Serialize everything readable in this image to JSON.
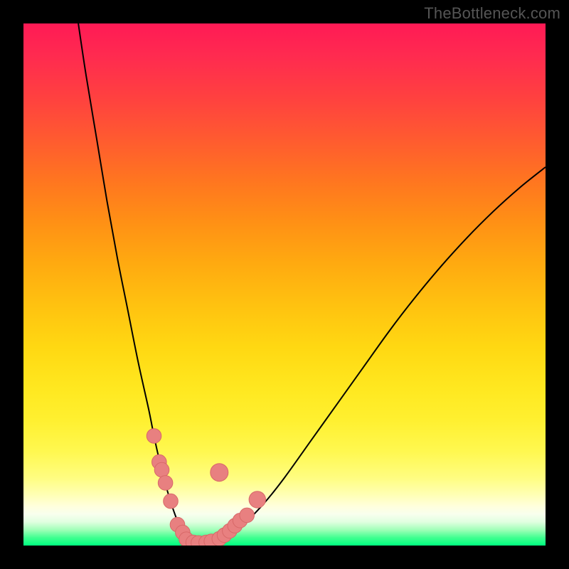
{
  "watermark": "TheBottleneck.com",
  "chart_data": {
    "type": "line",
    "title": "",
    "xlabel": "",
    "ylabel": "",
    "xlim": [
      0,
      100
    ],
    "ylim": [
      0,
      100
    ],
    "annotations": [],
    "series": [
      {
        "name": "bottleneck-curve",
        "x": [
          10.5,
          12,
          14,
          16,
          18,
          20,
          22,
          24,
          25,
          26,
          27,
          28,
          29,
          30,
          31,
          32.5,
          34,
          36,
          38,
          42,
          46,
          50,
          55,
          60,
          65,
          70,
          75,
          80,
          85,
          90,
          95,
          100
        ],
        "values": [
          100,
          90,
          78,
          66,
          55,
          45,
          35,
          26,
          21,
          16.5,
          12.5,
          9,
          6,
          3.5,
          1.8,
          0.5,
          0.5,
          0.8,
          1.5,
          4,
          8,
          13,
          20,
          27,
          34,
          41,
          47.5,
          53.5,
          59,
          64,
          68.5,
          72.5
        ]
      }
    ],
    "markers": [
      {
        "x": 25.0,
        "y": 21.0,
        "r": 1.4
      },
      {
        "x": 26.0,
        "y": 16.0,
        "r": 1.4
      },
      {
        "x": 26.5,
        "y": 14.5,
        "r": 1.4
      },
      {
        "x": 27.2,
        "y": 12.0,
        "r": 1.4
      },
      {
        "x": 28.2,
        "y": 8.5,
        "r": 1.4
      },
      {
        "x": 29.5,
        "y": 4.0,
        "r": 1.4
      },
      {
        "x": 30.5,
        "y": 2.5,
        "r": 1.4
      },
      {
        "x": 31.2,
        "y": 1.2,
        "r": 1.4
      },
      {
        "x": 32.5,
        "y": 0.6,
        "r": 1.4
      },
      {
        "x": 33.5,
        "y": 0.5,
        "r": 1.4
      },
      {
        "x": 35.0,
        "y": 0.6,
        "r": 1.4
      },
      {
        "x": 36.0,
        "y": 0.8,
        "r": 1.4
      },
      {
        "x": 37.5,
        "y": 1.3,
        "r": 1.4
      },
      {
        "x": 38.5,
        "y": 2.0,
        "r": 1.4
      },
      {
        "x": 39.5,
        "y": 2.8,
        "r": 1.4
      },
      {
        "x": 40.5,
        "y": 3.8,
        "r": 1.4
      },
      {
        "x": 41.5,
        "y": 4.8,
        "r": 1.4
      },
      {
        "x": 42.8,
        "y": 5.8,
        "r": 1.4
      },
      {
        "x": 44.8,
        "y": 8.8,
        "r": 1.6
      },
      {
        "x": 37.5,
        "y": 14.0,
        "r": 1.7
      }
    ],
    "colors": {
      "curve": "#000000",
      "marker_fill": "#e88080",
      "marker_stroke": "#d86868"
    }
  }
}
